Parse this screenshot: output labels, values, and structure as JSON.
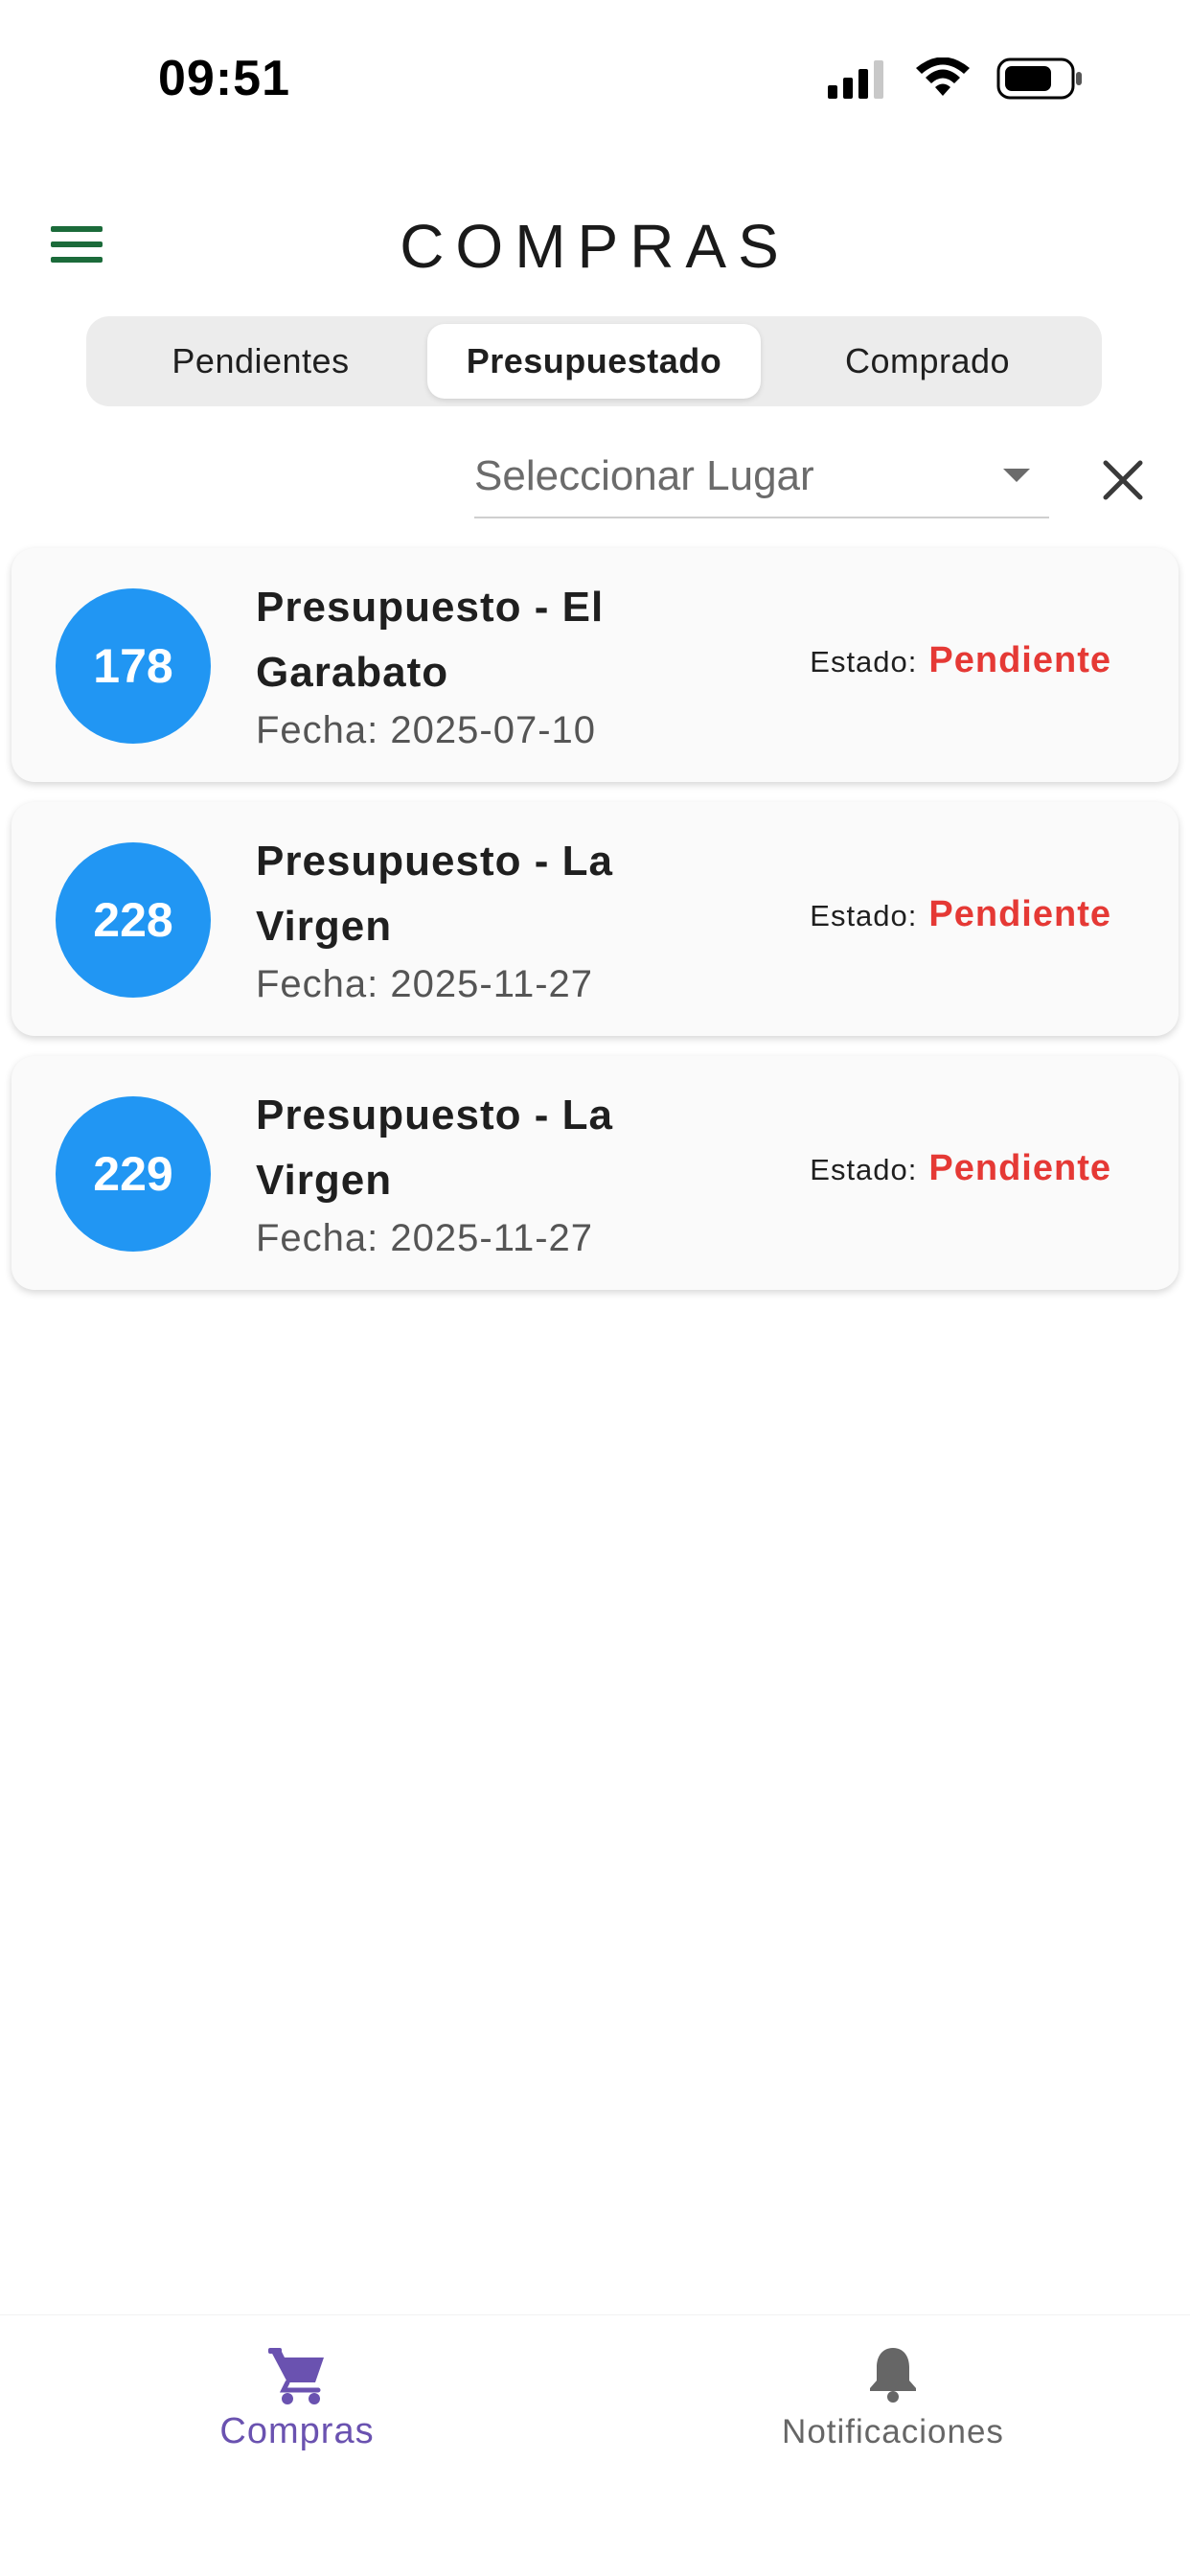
{
  "status_bar": {
    "time": "09:51"
  },
  "header": {
    "title": "COMPRAS",
    "menu_icon": "hamburger-menu-icon",
    "menu_icon_color": "#1b6b3a"
  },
  "tabs": [
    {
      "label": "Pendientes",
      "active": false
    },
    {
      "label": "Presupuestado",
      "active": true
    },
    {
      "label": "Comprado",
      "active": false
    }
  ],
  "filter": {
    "place_placeholder": "Seleccionar Lugar",
    "clear_icon": "close-icon"
  },
  "cards": [
    {
      "number": "178",
      "title": "Presupuesto - El Garabato",
      "date": "Fecha: 2025-07-10",
      "status_label": "Estado:",
      "status_value": "Pendiente"
    },
    {
      "number": "228",
      "title": "Presupuesto - La Virgen",
      "date": "Fecha: 2025-11-27",
      "status_label": "Estado:",
      "status_value": "Pendiente"
    },
    {
      "number": "229",
      "title": "Presupuesto - La Virgen",
      "date": "Fecha: 2025-11-27",
      "status_label": "Estado:",
      "status_value": "Pendiente"
    }
  ],
  "bottom_nav": {
    "compras_label": "Compras",
    "notificaciones_label": "Notificaciones",
    "compras_icon": "shopping-cart-icon",
    "notificaciones_icon": "bell-icon"
  },
  "colors": {
    "badge": "#2196f3",
    "status_pending": "#e53935",
    "nav_active": "#6a52b0",
    "nav_inactive": "#666666"
  }
}
